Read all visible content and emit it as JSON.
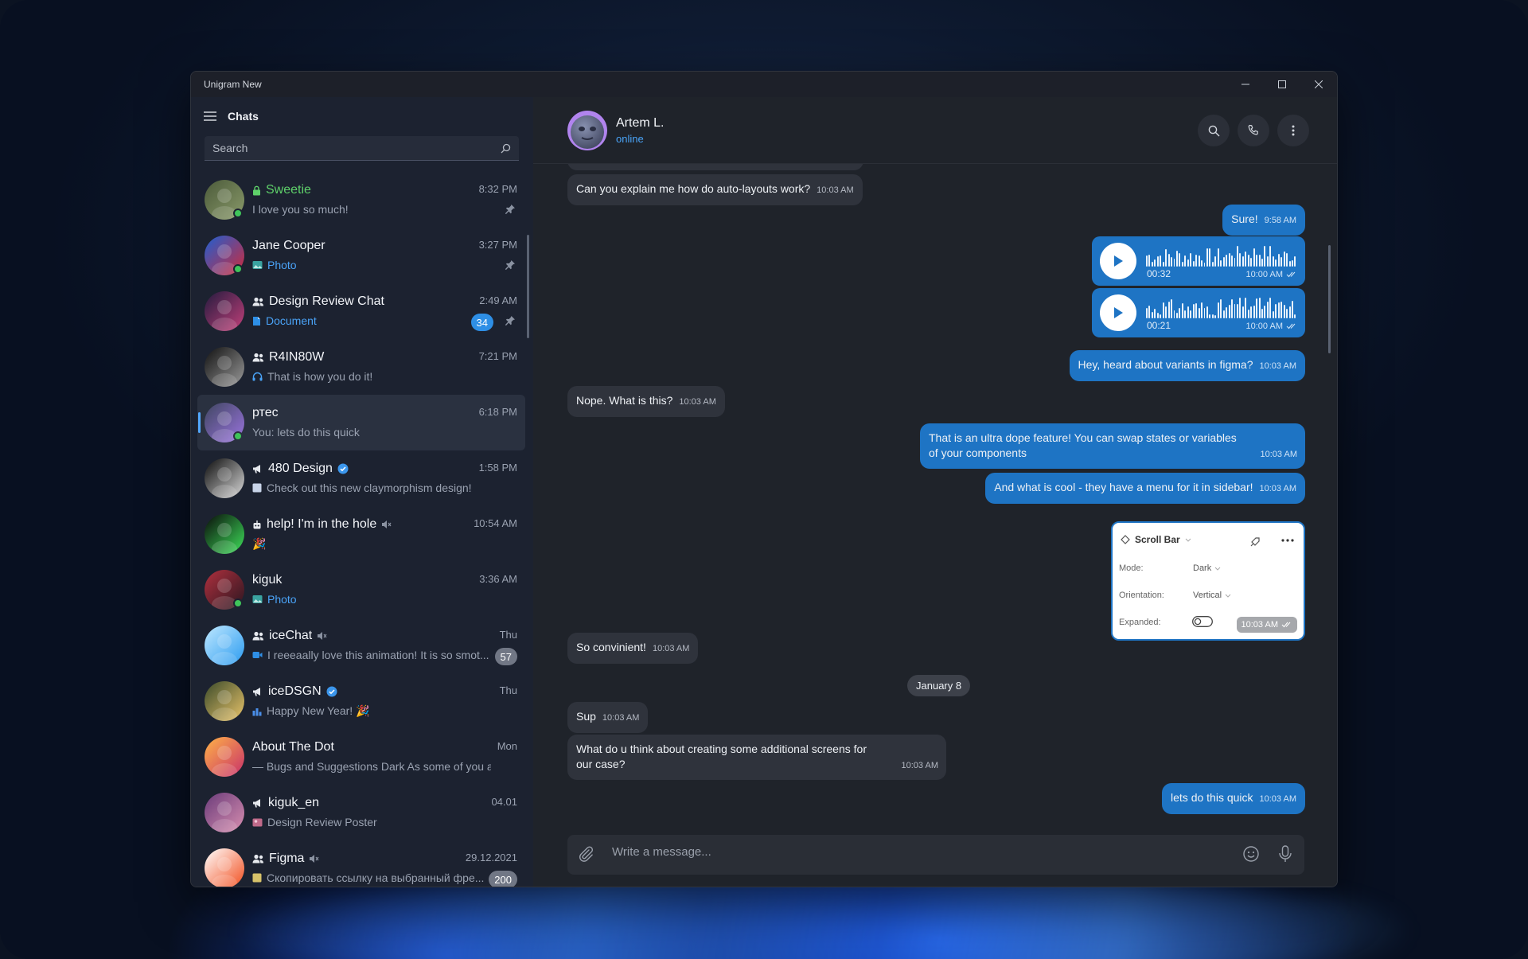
{
  "window": {
    "title": "Unigram New"
  },
  "sidebar": {
    "header_label": "Chats",
    "search_placeholder": "Search",
    "chats": [
      {
        "name": "Sweetie",
        "time": "8:32 PM",
        "message": "I love you so much!",
        "prefix": "",
        "online": true,
        "pinned": true,
        "badge": "",
        "kind": "secret",
        "colors": [
          "#4b5a3a",
          "#8a9a6a"
        ]
      },
      {
        "name": "Jane Cooper",
        "time": "3:27 PM",
        "message": "",
        "prefix": "Photo",
        "online": true,
        "pinned": true,
        "badge": "",
        "kind": "user",
        "colors": [
          "#1f5fd1",
          "#d02a3a"
        ]
      },
      {
        "name": "Design Review Chat",
        "time": "2:49 AM",
        "message": "",
        "prefix": "Document",
        "online": false,
        "pinned": true,
        "badge": "34",
        "kind": "group",
        "colors": [
          "#231b3e",
          "#c2407a"
        ]
      },
      {
        "name": "R4IN80W",
        "time": "7:21 PM",
        "message": "That is how you do it!",
        "prefix": "",
        "online": false,
        "pinned": false,
        "badge": "",
        "kind": "group",
        "colors": [
          "#111111",
          "#9a9a9a"
        ]
      },
      {
        "name": "ртес",
        "time": "6:18 PM",
        "message": "You: lets do this quick",
        "prefix": "",
        "online": true,
        "pinned": false,
        "badge": "",
        "kind": "user",
        "colors": [
          "#3f4660",
          "#9b74e0"
        ]
      },
      {
        "name": "480 Design",
        "time": "1:58 PM",
        "message": "Check out this new claymorphism design!",
        "prefix": "",
        "online": false,
        "pinned": false,
        "badge": "",
        "kind": "channel",
        "colors": [
          "#0c0c0c",
          "#d9d9d9"
        ]
      },
      {
        "name": "help! I'm in the hole",
        "time": "10:54 AM",
        "message": "🎉",
        "prefix": "",
        "online": false,
        "pinned": false,
        "badge": "",
        "kind": "bot",
        "colors": [
          "#0a0a0a",
          "#3ee05a"
        ]
      },
      {
        "name": "kiguk",
        "time": "3:36 AM",
        "message": "",
        "prefix": "Photo",
        "online": true,
        "pinned": false,
        "badge": "",
        "kind": "user",
        "colors": [
          "#b0303e",
          "#2a1620"
        ]
      },
      {
        "name": "iceChat",
        "time": "Thu",
        "message": "I reeeaally love this animation! It is so smot...",
        "prefix": "",
        "online": false,
        "pinned": false,
        "badge": "57",
        "kind": "group",
        "colors": [
          "#bfe8ff",
          "#2b9bf0"
        ]
      },
      {
        "name": "iceDSGN",
        "time": "Thu",
        "message": "Happy New Year! 🎉",
        "prefix": "",
        "online": false,
        "pinned": false,
        "badge": "",
        "kind": "channel",
        "colors": [
          "#3a4a2a",
          "#e9c46a"
        ]
      },
      {
        "name": "About The Dot",
        "time": "Mon",
        "message": "— Bugs and Suggestions Dark As some of you are ...",
        "prefix": "",
        "online": false,
        "pinned": false,
        "badge": "",
        "kind": "user",
        "colors": [
          "#ffb347",
          "#c8306a"
        ]
      },
      {
        "name": "kiguk_en",
        "time": "04.01",
        "message": "Design Review Poster",
        "prefix": "",
        "online": false,
        "pinned": false,
        "badge": "",
        "kind": "channel",
        "colors": [
          "#6a3b7a",
          "#d88fb0"
        ]
      },
      {
        "name": "Figma",
        "time": "29.12.2021",
        "message": "Скопировать ссылку на выбранный фре...",
        "prefix": "",
        "online": false,
        "pinned": false,
        "badge": "200",
        "kind": "group",
        "colors": [
          "#ffffff",
          "#f24e1e"
        ]
      }
    ]
  },
  "conversation": {
    "name": "Artem L.",
    "status": "online",
    "messages": {
      "m1": {
        "text": "Can you explain me how do auto-layouts work?",
        "time": "10:03 AM"
      },
      "m2": {
        "text": "Sure!",
        "time": "9:58 AM"
      },
      "v1": {
        "duration": "00:32",
        "time": "10:00 AM"
      },
      "v2": {
        "duration": "00:21",
        "time": "10:00 AM"
      },
      "m3": {
        "text": "Hey, heard about variants in figma?",
        "time": "10:03 AM"
      },
      "m4": {
        "text": "Nope. What is this?",
        "time": "10:03 AM"
      },
      "m5": {
        "text": "That is an ultra dope feature! You can swap states or variables of your components",
        "time": "10:03 AM"
      },
      "m6": {
        "text": "And what is cool - they have a menu for it in sidebar!",
        "time": "10:03 AM"
      },
      "card": {
        "title": "Scroll Bar",
        "mode_label": "Mode:",
        "mode_value": "Dark",
        "orientation_label": "Orientation:",
        "orientation_value": "Vertical",
        "expanded_label": "Expanded:",
        "time": "10:03 AM"
      },
      "m7": {
        "text": "So convinient!",
        "time": "10:03 AM"
      },
      "date": "January 8",
      "m8": {
        "text": "Sup",
        "time": "10:03 AM"
      },
      "m9": {
        "text": "What do u think about creating some additional screens for our case?",
        "time": "10:03 AM"
      },
      "m10": {
        "text": "lets do this quick",
        "time": "10:03 AM"
      }
    },
    "composer_placeholder": "Write a message..."
  }
}
